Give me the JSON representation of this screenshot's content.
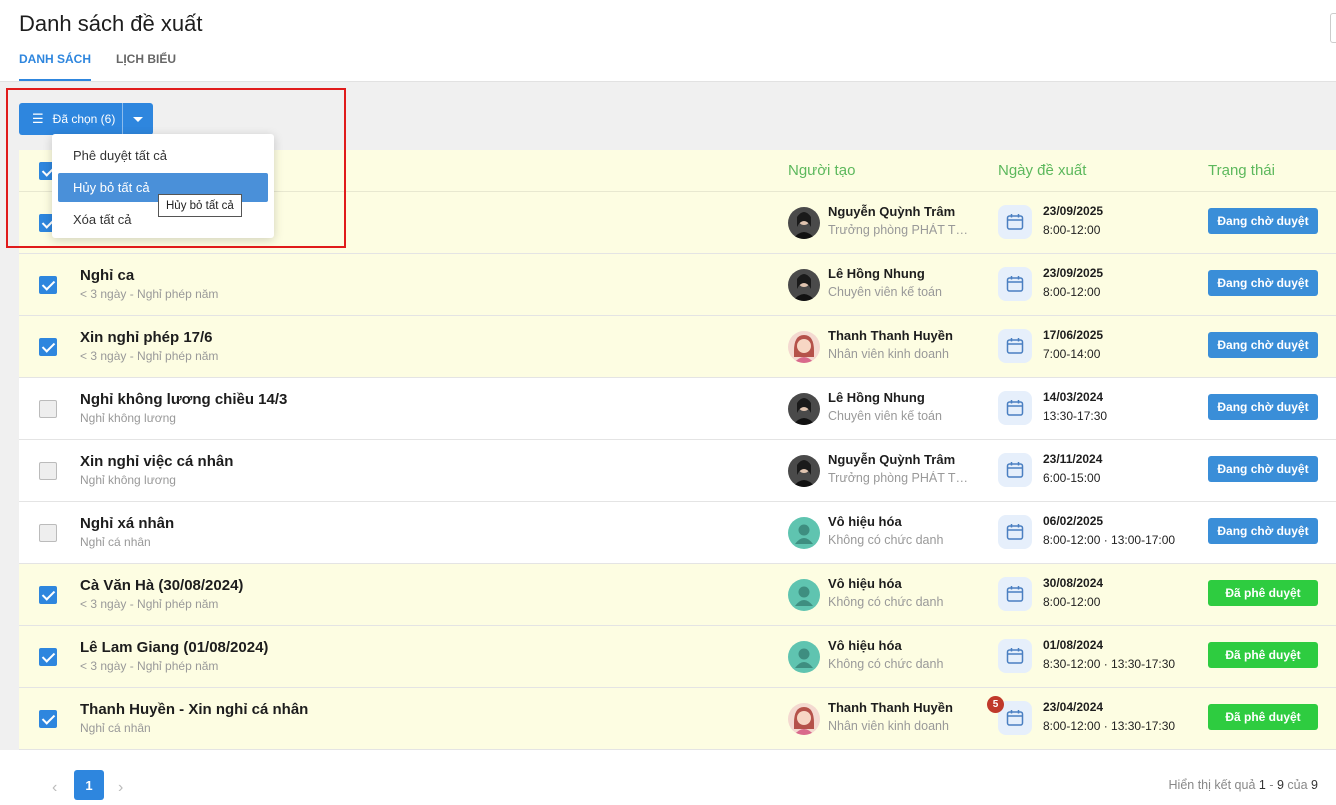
{
  "header": {
    "title": "Danh sách đề xuất",
    "tabs": [
      {
        "label": "DANH SÁCH",
        "active": true
      },
      {
        "label": "LỊCH BIỂU",
        "active": false
      }
    ]
  },
  "toolbar": {
    "selected_label": "Đã chọn (6)"
  },
  "dropdown": {
    "items": [
      "Phê duyệt tất cả",
      "Hủy bỏ tất cả",
      "Xóa tất cả"
    ],
    "active_index": 1,
    "tooltip": "Hủy bỏ tất cả"
  },
  "table": {
    "columns": {
      "creator": "Người tạo",
      "date": "Ngày đề xuất",
      "status": "Trạng thái"
    },
    "rows": [
      {
        "title": "",
        "subtitle": "",
        "checked": true,
        "creator_name": "Nguyễn Quỳnh Trâm",
        "creator_role": "Trưởng phòng PHÁT TRIỂN",
        "avatar": "photo-dark",
        "date": "23/09/2025",
        "time": "8:00-12:00",
        "status": "Đang chờ duyệt",
        "status_type": "pending",
        "badge": ""
      },
      {
        "title": "Nghỉ ca",
        "subtitle": "< 3 ngày - Nghỉ phép năm",
        "checked": true,
        "creator_name": "Lê Hồng Nhung",
        "creator_role": "Chuyên viên kế toán",
        "avatar": "photo-dark",
        "date": "23/09/2025",
        "time": "8:00-12:00",
        "status": "Đang chờ duyệt",
        "status_type": "pending",
        "badge": ""
      },
      {
        "title": "Xin nghỉ phép 17/6",
        "subtitle": "< 3 ngày - Nghỉ phép năm",
        "checked": true,
        "creator_name": "Thanh Thanh Huyền",
        "creator_role": "Nhân viên kinh doanh",
        "avatar": "cartoon-woman",
        "date": "17/06/2025",
        "time": "7:00-14:00",
        "status": "Đang chờ duyệt",
        "status_type": "pending",
        "badge": ""
      },
      {
        "title": "Nghỉ không lương chiều 14/3",
        "subtitle": "Nghỉ không lương",
        "checked": false,
        "creator_name": "Lê Hồng Nhung",
        "creator_role": "Chuyên viên kế toán",
        "avatar": "photo-dark",
        "date": "14/03/2024",
        "time": "13:30-17:30",
        "status": "Đang chờ duyệt",
        "status_type": "pending",
        "badge": ""
      },
      {
        "title": "Xin nghỉ việc cá nhân",
        "subtitle": "Nghỉ không lương",
        "checked": false,
        "creator_name": "Nguyễn Quỳnh Trâm",
        "creator_role": "Trưởng phòng PHÁT TRIỂN",
        "avatar": "photo-dark",
        "date": "23/11/2024",
        "time": "6:00-15:00",
        "status": "Đang chờ duyệt",
        "status_type": "pending",
        "badge": ""
      },
      {
        "title": "Nghỉ xá nhân",
        "subtitle": "Nghỉ cá nhân",
        "checked": false,
        "creator_name": "Vô hiệu hóa",
        "creator_role": "Không có chức danh",
        "avatar": "generic-user",
        "date": "06/02/2025",
        "time": "8:00-12:00 · 13:00-17:00",
        "status": "Đang chờ duyệt",
        "status_type": "pending",
        "badge": ""
      },
      {
        "title": "Cà Văn Hà (30/08/2024)",
        "subtitle": "< 3 ngày - Nghỉ phép năm",
        "checked": true,
        "creator_name": "Vô hiệu hóa",
        "creator_role": "Không có chức danh",
        "avatar": "generic-user",
        "date": "30/08/2024",
        "time": "8:00-12:00",
        "status": "Đã phê duyệt",
        "status_type": "approved",
        "badge": ""
      },
      {
        "title": "Lê Lam Giang (01/08/2024)",
        "subtitle": "< 3 ngày - Nghỉ phép năm",
        "checked": true,
        "creator_name": "Vô hiệu hóa",
        "creator_role": "Không có chức danh",
        "avatar": "generic-user",
        "date": "01/08/2024",
        "time": "8:30-12:00 · 13:30-17:30",
        "status": "Đã phê duyệt",
        "status_type": "approved",
        "badge": ""
      },
      {
        "title": "Thanh Huyền - Xin nghỉ cá nhân",
        "subtitle": "Nghỉ cá nhân",
        "checked": true,
        "creator_name": "Thanh Thanh Huyền",
        "creator_role": "Nhân viên kinh doanh",
        "avatar": "cartoon-woman",
        "date": "23/04/2024",
        "time": "8:00-12:00 · 13:30-17:30",
        "status": "Đã phê duyệt",
        "status_type": "approved",
        "badge": "5"
      }
    ]
  },
  "pagination": {
    "current_page": "1",
    "prev_icon": "chevron-left-icon",
    "next_icon": "chevron-right-icon",
    "info_prefix": "Hiển thị kết quả",
    "range_start": "1",
    "range_sep": "-",
    "range_end": "9",
    "of_label": "của",
    "total": "9"
  },
  "colors": {
    "accent": "#2e86de",
    "pending": "#3a8ed8",
    "approved": "#2ecc40",
    "header_green": "#5cb85c",
    "selected_row": "#fdfde2",
    "highlight": "#e01b1b"
  }
}
